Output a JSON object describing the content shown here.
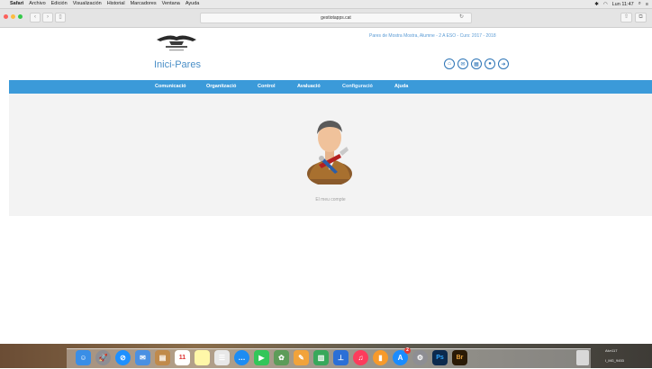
{
  "menubar": {
    "app": "Safari",
    "items": [
      "Archivo",
      "Edición",
      "Visualización",
      "Historial",
      "Marcadores",
      "Ventana",
      "Ayuda"
    ],
    "clock": "Lun 11:47"
  },
  "browser": {
    "url": "gestiotapps.cat"
  },
  "site": {
    "title": "Inici-Pares",
    "user_info": "Pares de Mostra Mostra, Alumne - 2 A ESO - Curs: 2017 - 2018"
  },
  "nav": {
    "items": [
      "Comunicació",
      "Organització",
      "Control",
      "Avaluació",
      "Configuració",
      "Ajuda"
    ],
    "active": "Configuració"
  },
  "content": {
    "account_label": "El meu compte"
  },
  "dock": {
    "calendar_day": "11",
    "badge": "2"
  },
  "desktop": {
    "labels": [
      "Atvr117",
      "I_MG_9453"
    ]
  },
  "colors": {
    "nav_blue": "#3b9ad9",
    "title_blue": "#4a8fc7",
    "icon_blue": "#2b73b6"
  }
}
